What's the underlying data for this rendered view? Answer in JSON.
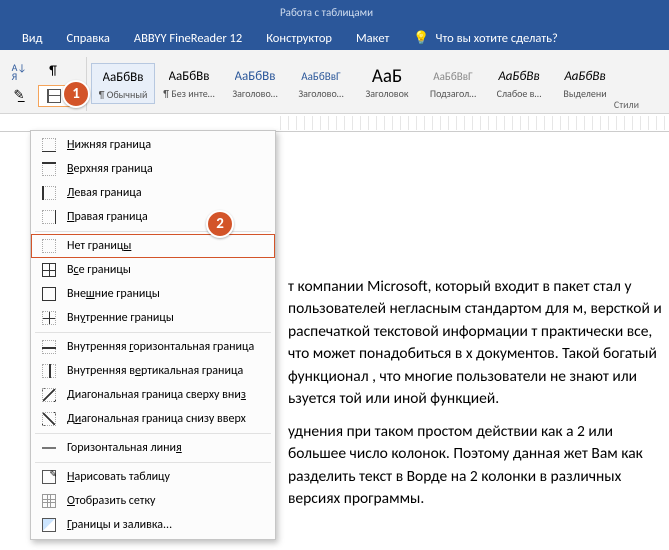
{
  "app": {
    "context_title": "Работа с таблицами",
    "tell_me": "Что вы хотите сделать?"
  },
  "tabs": [
    "Вид",
    "Справка",
    "ABBYY FineReader 12",
    "Конструктор",
    "Макет"
  ],
  "ribbon": {
    "styles_group": "Стили",
    "styles": [
      {
        "preview": "АаБбВв",
        "name": "¶ Обычный",
        "color": "#000",
        "ff": "inherit",
        "sel": true
      },
      {
        "preview": "АаБбВв",
        "name": "¶ Без инте…",
        "color": "#000",
        "ff": "inherit"
      },
      {
        "preview": "АаБбВв",
        "name": "Заголово…",
        "color": "#2b579a",
        "ff": "inherit"
      },
      {
        "preview": "АаБбВвГ",
        "name": "Заголово…",
        "color": "#2b579a",
        "ff": "inherit",
        "fs": "11px"
      },
      {
        "preview": "АаБ",
        "name": "Заголовок",
        "color": "#000",
        "ff": "inherit",
        "fs": "19px"
      },
      {
        "preview": "АаБбВвГ",
        "name": "Подзагол…",
        "color": "#888",
        "ff": "inherit",
        "fs": "11px"
      },
      {
        "preview": "АаБбВв",
        "name": "Слабое в…",
        "color": "#000",
        "ff": "inherit",
        "fi": "italic"
      },
      {
        "preview": "АаБбВв",
        "name": "Выделени",
        "color": "#000",
        "ff": "inherit",
        "fi": "italic"
      }
    ]
  },
  "markers": {
    "m1": "1",
    "m2": "2"
  },
  "dropdown": [
    {
      "icon": "bi bi-bottom",
      "pre": "",
      "u": "Н",
      "post": "ижняя граница"
    },
    {
      "icon": "bi bi-top",
      "pre": "",
      "u": "В",
      "post": "ерхняя граница"
    },
    {
      "icon": "bi bi-left",
      "pre": "",
      "u": "Л",
      "post": "евая граница"
    },
    {
      "icon": "bi bi-right",
      "pre": "",
      "u": "П",
      "post": "равая граница"
    },
    {
      "sep": true
    },
    {
      "icon": "bi bi-none",
      "pre": "Нет границ",
      "u": "ы",
      "post": "",
      "hl": true
    },
    {
      "icon": "bi bi-all",
      "pre": "В",
      "u": "с",
      "post": "е границы"
    },
    {
      "icon": "bi bi-outer",
      "pre": "Вне",
      "u": "ш",
      "post": "ние границы"
    },
    {
      "icon": "bi bi-inner",
      "pre": "Вн",
      "u": "у",
      "post": "тренние границы"
    },
    {
      "sep": true
    },
    {
      "icon": "bi bi-inh",
      "pre": "Внутренняя ",
      "u": "г",
      "post": "оризонтальная граница"
    },
    {
      "icon": "bi bi-inv",
      "pre": "Внутренняя в",
      "u": "е",
      "post": "ртикальная граница"
    },
    {
      "icon": "bi bi-diag1",
      "pre": "Диагональная граница сверху вни",
      "u": "з",
      "post": ""
    },
    {
      "icon": "bi bi-diag2",
      "pre": "Д",
      "u": "и",
      "post": "агональная граница снизу вверх"
    },
    {
      "sep": true
    },
    {
      "icon": "hrline",
      "pre": "Горизонтальная лини",
      "u": "я",
      "post": ""
    },
    {
      "sep": true
    },
    {
      "icon": "draw-ic",
      "pre": "",
      "u": "Н",
      "post": "арисовать таблицу"
    },
    {
      "icon": "grid-ic",
      "pre": "",
      "u": "О",
      "post": "тобразить сетку"
    },
    {
      "icon": "fill-ic",
      "pre": "",
      "u": "Г",
      "post": "раницы и заливка..."
    }
  ],
  "doc": {
    "p1": "т компании Microsoft, который входит в пакет стал у пользователей негласным стандартом для м, версткой и распечаткой текстовой информации т практически все, что может понадобиться в х документов. Такой богатый функционал , что многие пользователи не знают или ьзуется той или иной функцией.",
    "p2": "уднения при таком простом действии как а 2 или большее число колонок. Поэтому данная жет Вам как разделить текст в Ворде на 2 колонки в различных версиях программы."
  }
}
